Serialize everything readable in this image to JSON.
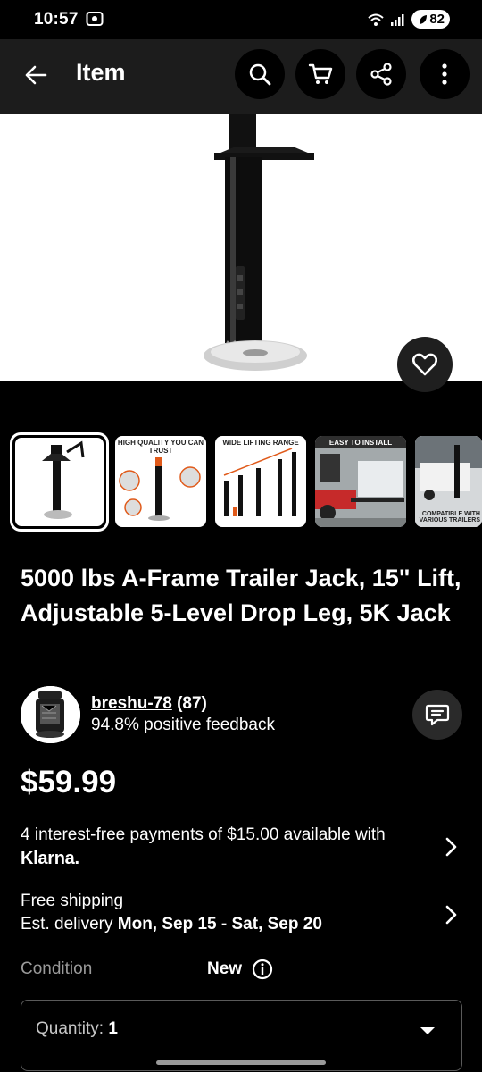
{
  "status": {
    "time": "10:57",
    "battery": "82"
  },
  "app_bar": {
    "title": "Item"
  },
  "thumbnails": [
    {
      "caption": ""
    },
    {
      "caption": "HIGH QUALITY YOU CAN TRUST"
    },
    {
      "caption": "WIDE LIFTING RANGE"
    },
    {
      "caption": "EASY TO INSTALL"
    },
    {
      "caption": "COMPATIBLE WITH VARIOUS TRAILERS"
    }
  ],
  "listing": {
    "title": "5000 lbs A-Frame Trailer Jack, 15\" Lift, Adjustable 5-Level Drop Leg, 5K Jack",
    "price": "$59.99"
  },
  "seller": {
    "name": "breshu-78",
    "count": "(87)",
    "feedback": "94.8% positive feedback"
  },
  "payments": {
    "text": "4 interest-free payments of $15.00 available with",
    "provider": "Klarna."
  },
  "shipping": {
    "title": "Free shipping",
    "delivery_prefix": "Est. delivery",
    "delivery_dates": "Mon, Sep 15 - Sat, Sep 20"
  },
  "condition": {
    "label": "Condition",
    "value": "New"
  },
  "quantity": {
    "label": "Quantity:",
    "value": "1"
  }
}
